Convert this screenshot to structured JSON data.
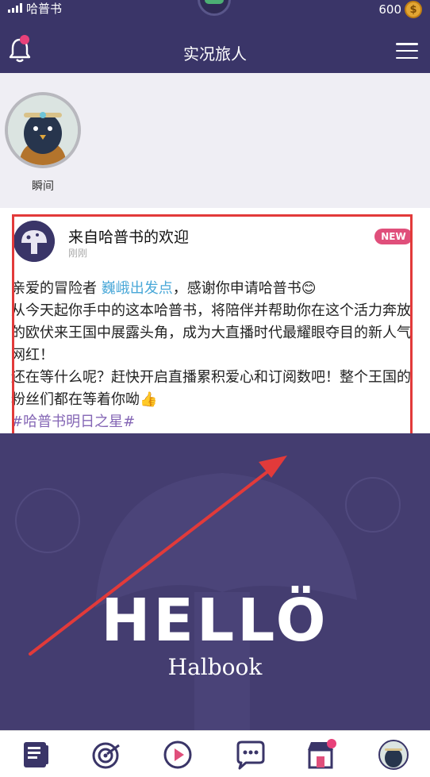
{
  "status": {
    "carrier": "哈普书",
    "coins": "600",
    "coin_symbol": "$"
  },
  "header": {
    "title": "实况旅人"
  },
  "story": {
    "label": "瞬间"
  },
  "post": {
    "title": "来自哈普书的欢迎",
    "time": "刚刚",
    "badge": "NEW",
    "line1_prefix": "亲爱的冒险者 ",
    "line1_highlight": "巍峨出发点",
    "line1_suffix": "，感谢你申请哈普书😊",
    "line2": "从今天起你手中的这本哈普书，将陪伴并帮助你在这个活力奔放的欧伏来王国中展露头角，成为大直播时代最耀眼夺目的新人气网红！",
    "line3": "还在等什么呢？赶快开启直播累积爱心和订阅数吧！整个王国的粉丝们都在等着你呦👍",
    "hashtag": "#哈普书明日之星#"
  },
  "banner": {
    "title": "HELLÖ",
    "subtitle": "Halbook"
  },
  "colors": {
    "header_bg": "#3a3568",
    "accent_pink": "#e04f7b",
    "highlight_frame": "#e23a3a",
    "banner_bg": "#443d70"
  },
  "tabbar": {
    "items": [
      "book-icon",
      "target-icon",
      "play-icon",
      "chat-icon",
      "shop-icon",
      "profile-icon"
    ]
  }
}
